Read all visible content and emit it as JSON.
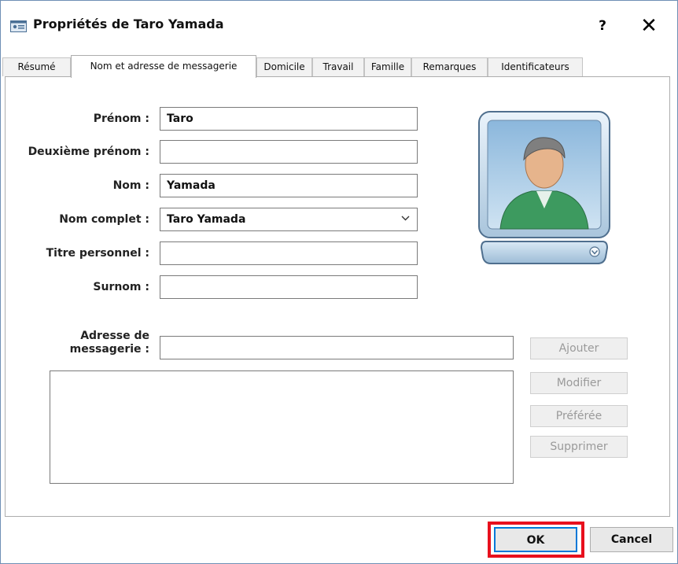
{
  "window": {
    "title": "Propriétés de Taro Yamada",
    "help_label": "?",
    "close_label": "✕"
  },
  "tabs": [
    {
      "label": "Résumé",
      "active": false
    },
    {
      "label": "Nom et adresse de messagerie",
      "active": true
    },
    {
      "label": "Domicile",
      "active": false
    },
    {
      "label": "Travail",
      "active": false
    },
    {
      "label": "Famille",
      "active": false
    },
    {
      "label": "Remarques",
      "active": false
    },
    {
      "label": "Identificateurs",
      "active": false
    }
  ],
  "form": {
    "first_name": {
      "label": "Prénom :",
      "value": "Taro"
    },
    "middle_name": {
      "label": "Deuxième prénom :",
      "value": ""
    },
    "last_name": {
      "label": "Nom :",
      "value": "Yamada"
    },
    "full_name": {
      "label": "Nom complet :",
      "value": "Taro Yamada"
    },
    "personal_title": {
      "label": "Titre personnel :",
      "value": ""
    },
    "nickname": {
      "label": "Surnom :",
      "value": ""
    },
    "email": {
      "label_line1": "Adresse de",
      "label_line2": "messagerie :",
      "value": ""
    }
  },
  "email_buttons": {
    "add": "Ajouter",
    "edit": "Modifier",
    "preferred": "Préférée",
    "delete": "Supprimer"
  },
  "footer": {
    "ok": "OK",
    "cancel": "Cancel"
  },
  "colors": {
    "highlight": "#e8101d",
    "avatar_frame": "#aac7de",
    "shirt": "#3d9a5f"
  }
}
